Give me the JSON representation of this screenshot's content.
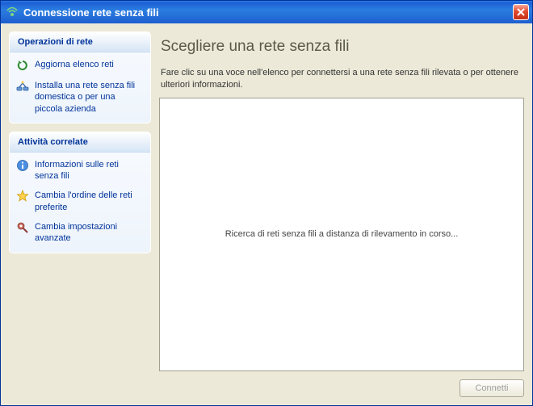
{
  "window": {
    "title": "Connessione rete senza fili"
  },
  "sidebar": {
    "panels": [
      {
        "header": "Operazioni di rete",
        "items": [
          {
            "label": "Aggiorna elenco reti",
            "icon": "refresh-icon"
          },
          {
            "label": "Installa una rete senza fili domestica o per una piccola azienda",
            "icon": "setup-network-icon"
          }
        ]
      },
      {
        "header": "Attività correlate",
        "items": [
          {
            "label": "Informazioni sulle reti senza fili",
            "icon": "info-icon"
          },
          {
            "label": "Cambia l'ordine delle reti preferite",
            "icon": "star-icon"
          },
          {
            "label": "Cambia impostazioni avanzate",
            "icon": "settings-icon"
          }
        ]
      }
    ]
  },
  "main": {
    "heading": "Scegliere una rete senza fili",
    "instruction": "Fare clic su una voce nell'elenco per connettersi a una rete senza fili rilevata o per ottenere ulteriori informazioni.",
    "status": "Ricerca di reti senza fili a distanza di rilevamento in corso...",
    "connect_label": "Connetti"
  }
}
